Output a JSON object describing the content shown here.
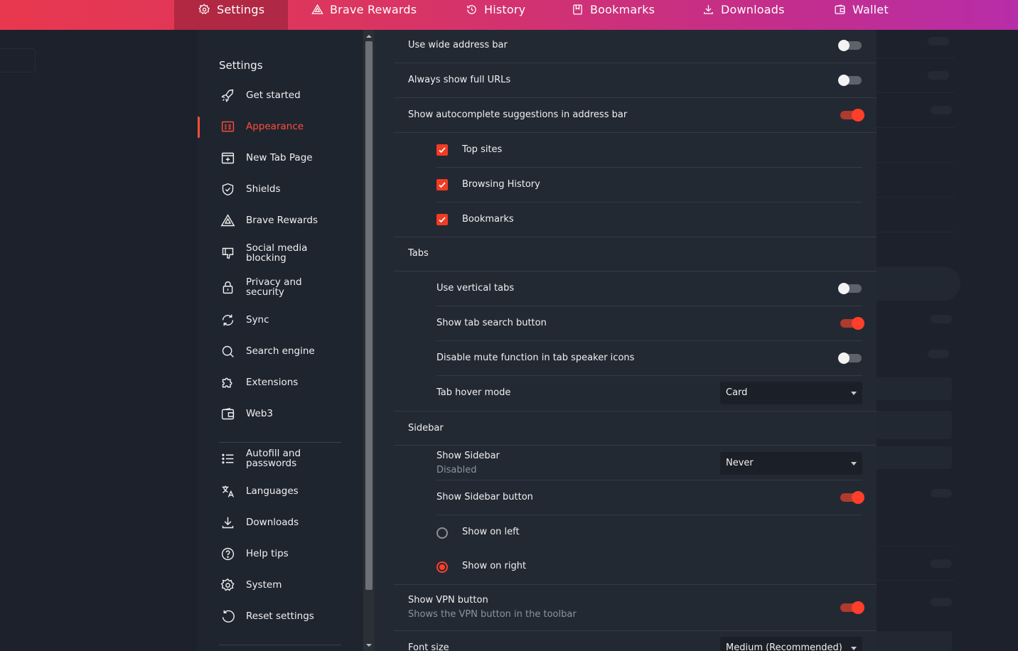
{
  "topbar": {
    "tabs": [
      {
        "label": "Settings",
        "icon": "gear-icon"
      },
      {
        "label": "Brave Rewards",
        "icon": "triangle-icon"
      },
      {
        "label": "History",
        "icon": "history-icon"
      },
      {
        "label": "Bookmarks",
        "icon": "bookmark-icon"
      },
      {
        "label": "Downloads",
        "icon": "download-icon"
      },
      {
        "label": "Wallet",
        "icon": "wallet-icon"
      }
    ],
    "colors": {
      "start": "#e8384f",
      "end": "#b82da8"
    }
  },
  "sidebar": {
    "title": "Settings",
    "items": [
      {
        "label": "Get started",
        "icon": "rocket-icon"
      },
      {
        "label": "Appearance",
        "icon": "appearance-icon",
        "active": true
      },
      {
        "label": "New Tab Page",
        "icon": "new-tab-icon"
      },
      {
        "label": "Shields",
        "icon": "shield-icon"
      },
      {
        "label": "Brave Rewards",
        "icon": "triangle-icon"
      },
      {
        "label": "Social media blocking",
        "icon": "thumbs-down-icon"
      },
      {
        "label": "Privacy and security",
        "icon": "lock-icon"
      },
      {
        "label": "Sync",
        "icon": "sync-icon"
      },
      {
        "label": "Search engine",
        "icon": "search-icon"
      },
      {
        "label": "Extensions",
        "icon": "puzzle-icon"
      },
      {
        "label": "Web3",
        "icon": "wallet-icon"
      },
      {
        "label": "Autofill and passwords",
        "icon": "list-icon"
      },
      {
        "label": "Languages",
        "icon": "translate-icon"
      },
      {
        "label": "Downloads",
        "icon": "download-icon"
      },
      {
        "label": "Help tips",
        "icon": "help-icon"
      },
      {
        "label": "System",
        "icon": "gear-icon"
      },
      {
        "label": "Reset settings",
        "icon": "reset-icon"
      }
    ],
    "accent": "#ff4f3a"
  },
  "main": {
    "wide_address_bar": {
      "label": "Use wide address bar",
      "on": false
    },
    "full_urls": {
      "label": "Always show full URLs",
      "on": false
    },
    "autocomplete": {
      "label": "Show autocomplete suggestions in address bar",
      "on": true
    },
    "top_sites": {
      "label": "Top sites",
      "checked": true
    },
    "browsing_history": {
      "label": "Browsing History",
      "checked": true
    },
    "bookmarks": {
      "label": "Bookmarks",
      "checked": true
    },
    "tabs_heading": "Tabs",
    "vertical_tabs": {
      "label": "Use vertical tabs",
      "on": false
    },
    "tab_search": {
      "label": "Show tab search button",
      "on": true
    },
    "disable_mute": {
      "label": "Disable mute function in tab speaker icons",
      "on": false
    },
    "tab_hover": {
      "label": "Tab hover mode",
      "value": "Card"
    },
    "sidebar_heading": "Sidebar",
    "show_sidebar": {
      "label": "Show Sidebar",
      "sublabel": "Disabled",
      "value": "Never"
    },
    "sidebar_button": {
      "label": "Show Sidebar button",
      "on": true
    },
    "show_left": {
      "label": "Show on left",
      "selected": false
    },
    "show_right": {
      "label": "Show on right",
      "selected": true
    },
    "vpn_button": {
      "label": "Show VPN button",
      "sublabel": "Shows the VPN button in the toolbar",
      "on": true
    },
    "font_size": {
      "label": "Font size",
      "value": "Medium (Recommended)"
    }
  }
}
